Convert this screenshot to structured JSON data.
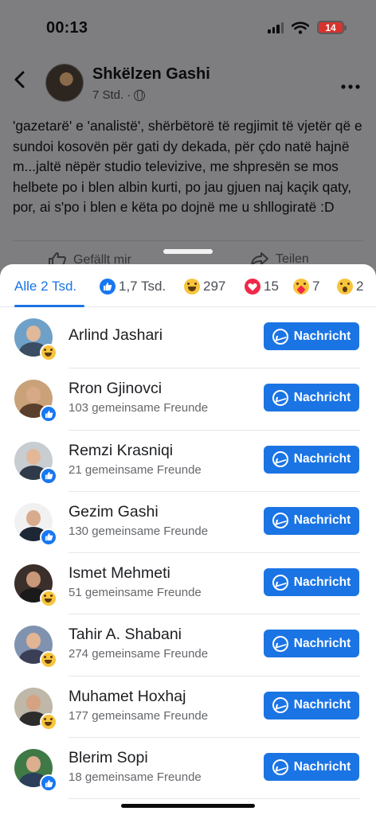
{
  "status_bar": {
    "time": "00:13",
    "battery": "14"
  },
  "post": {
    "author": "Shkëlzen Gashi",
    "meta": "7 Std. ·",
    "text": "'gazetarë' e 'analistë', shërbëtorë të regjimit të vjetër që e sundoi kosovën për gati dy dekada, për çdo natë hajnë m...jaltë nëpër studio televizive, me shpresën se mos helbete po i blen albin kurti, po jau gjuen naj kaçik qaty, por, ai s'po i blen e këta po dojnë me u shllogiratë :D",
    "like_action": "Gefällt mir",
    "share_action": "Teilen"
  },
  "tabs": {
    "all": "Alle 2 Tsd.",
    "like": "1,7 Tsd.",
    "haha": "297",
    "love": "15",
    "care": "7",
    "wow": "2"
  },
  "message_label": "Nachricht",
  "people": [
    {
      "name": "Arlind Jashari",
      "mutual": "",
      "reaction": "haha"
    },
    {
      "name": "Rron Gjinovci",
      "mutual": "103 gemeinsame Freunde",
      "reaction": "like"
    },
    {
      "name": "Remzi Krasniqi",
      "mutual": "21 gemeinsame Freunde",
      "reaction": "like"
    },
    {
      "name": "Gezim Gashi",
      "mutual": "130 gemeinsame Freunde",
      "reaction": "like"
    },
    {
      "name": "Ismet Mehmeti",
      "mutual": "51 gemeinsame Freunde",
      "reaction": "haha"
    },
    {
      "name": "Tahir A. Shabani",
      "mutual": "274 gemeinsame Freunde",
      "reaction": "haha"
    },
    {
      "name": "Muhamet Hoxhaj",
      "mutual": "177 gemeinsame Freunde",
      "reaction": "haha"
    },
    {
      "name": "Blerim Sopi",
      "mutual": "18 gemeinsame Freunde",
      "reaction": "like"
    }
  ],
  "colors": {
    "accent": "#1b74e4",
    "like": "#1877f2",
    "love": "#f02849",
    "haha": "#f7c43c"
  }
}
